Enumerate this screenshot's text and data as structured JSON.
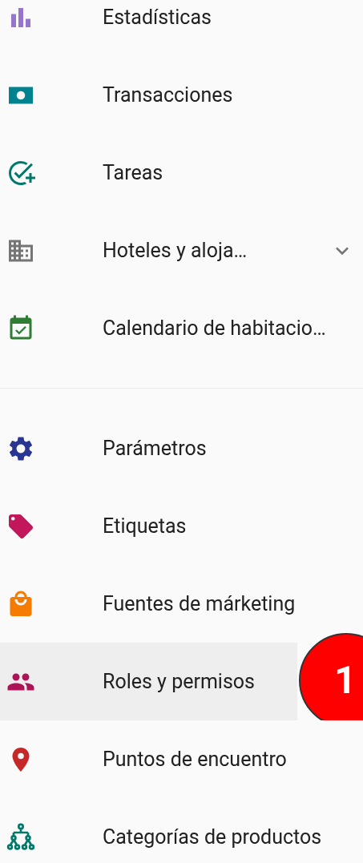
{
  "groups": [
    {
      "items": [
        {
          "kind": "stats",
          "label": "Estadísticas",
          "selected": false
        },
        {
          "kind": "money",
          "label": "Transacciones",
          "selected": false
        },
        {
          "kind": "tasks",
          "label": "Tareas",
          "selected": false
        },
        {
          "kind": "building",
          "label": "Hoteles y aloja…",
          "selected": false,
          "expanded": false
        },
        {
          "kind": "calendar",
          "label": "Calendario de habitacio…",
          "selected": false
        }
      ]
    },
    {
      "items": [
        {
          "kind": "settings",
          "label": "Parámetros",
          "selected": false
        },
        {
          "kind": "tag",
          "label": "Etiquetas",
          "selected": false
        },
        {
          "kind": "bag",
          "label": "Fuentes de márketing",
          "selected": false
        },
        {
          "kind": "people",
          "label": "Roles y permisos",
          "selected": true,
          "badge": "1"
        },
        {
          "kind": "place",
          "label": "Puntos de encuentro",
          "selected": false
        },
        {
          "kind": "tree",
          "label": "Categorías de productos",
          "selected": false
        }
      ]
    }
  ]
}
